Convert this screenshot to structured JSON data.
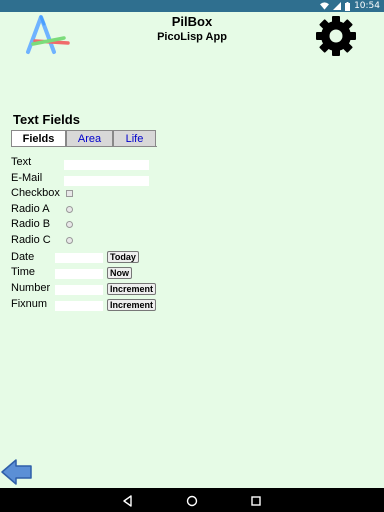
{
  "status": {
    "time": "10:54"
  },
  "app": {
    "title": "PilBox",
    "subtitle": "PicoLisp App"
  },
  "section_title": "Text Fields",
  "tabs": [
    {
      "label": "Fields",
      "active": true
    },
    {
      "label": "Area",
      "active": false
    },
    {
      "label": "Life",
      "active": false
    }
  ],
  "fields": {
    "text_label": "Text",
    "email_label": "E-Mail",
    "checkbox_label": "Checkbox",
    "radio_a_label": "Radio A",
    "radio_b_label": "Radio B",
    "radio_c_label": "Radio C",
    "date_label": "Date",
    "time_label": "Time",
    "number_label": "Number",
    "fixnum_label": "Fixnum",
    "text_value": "",
    "email_value": "",
    "date_value": "",
    "time_value": "",
    "number_value": "",
    "fixnum_value": ""
  },
  "buttons": {
    "today": "Today",
    "now": "Now",
    "increment_number": "Increment",
    "increment_fixnum": "Increment"
  },
  "colors": {
    "background": "#e6fbe6",
    "statusbar": "#2f6f8f",
    "back_arrow": "#5b8fd6",
    "tab_link": "#0000cc"
  }
}
